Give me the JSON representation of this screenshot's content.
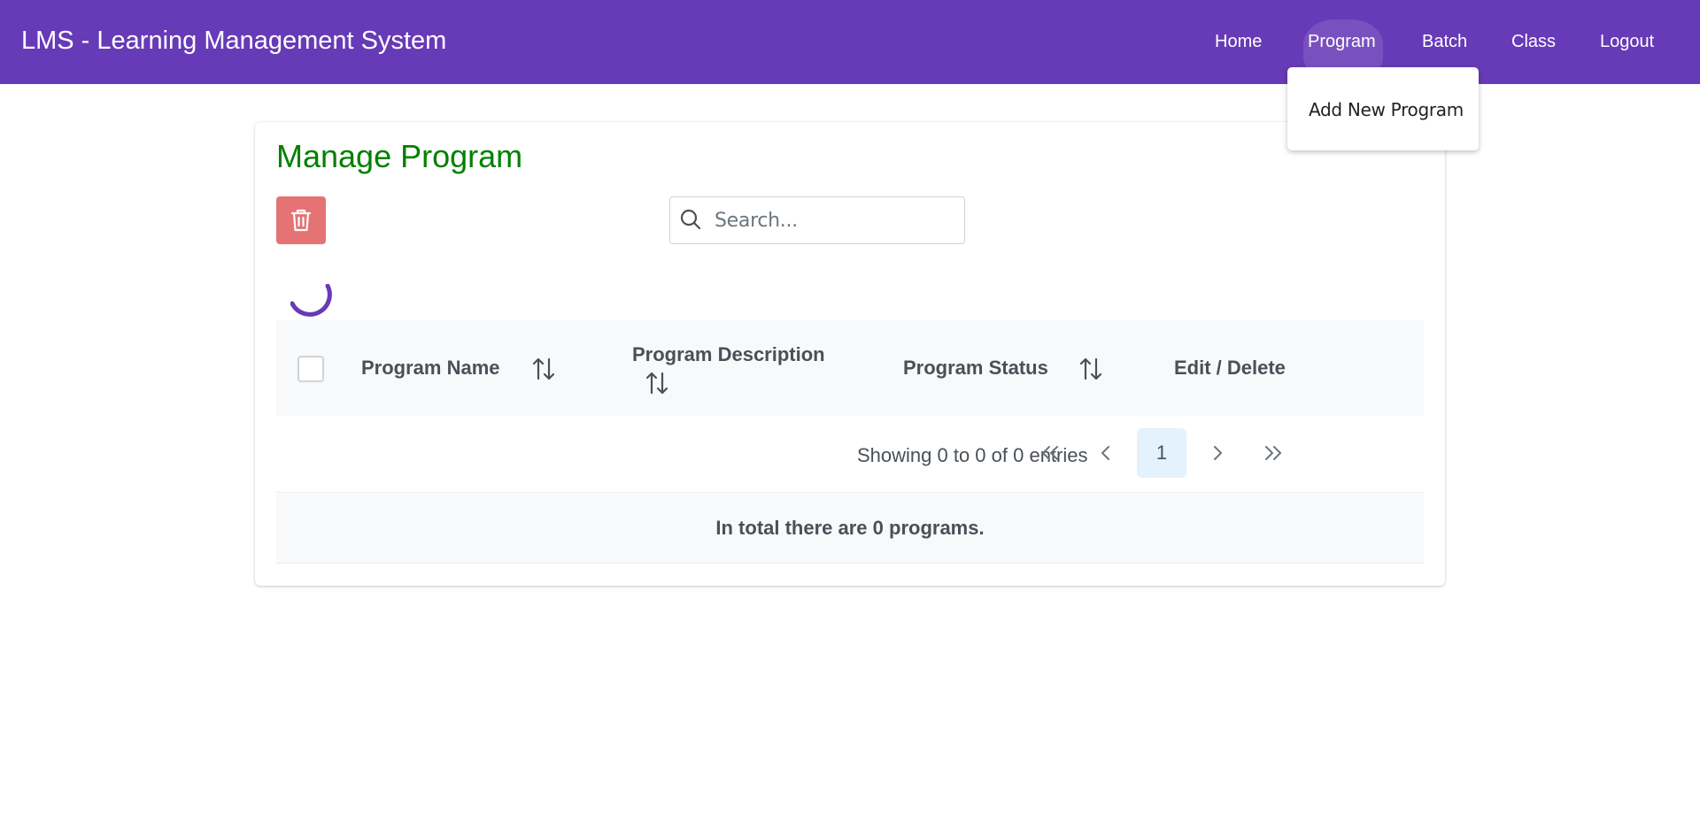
{
  "header": {
    "app_title": "LMS - Learning Management System",
    "nav": [
      {
        "label": "Home"
      },
      {
        "label": "Program"
      },
      {
        "label": "Batch"
      },
      {
        "label": "Class"
      },
      {
        "label": "Logout"
      }
    ],
    "active_nav": "Program",
    "background_color": "#673ab7"
  },
  "dropdown": {
    "items": [
      {
        "label": "Add New Program"
      }
    ]
  },
  "main": {
    "title": "Manage Program",
    "title_color": "#008000",
    "delete_button_color": "#e57373",
    "delete_icon": "trash-icon",
    "search": {
      "placeholder": "Search...",
      "value": "",
      "icon": "search-icon"
    },
    "table": {
      "columns": [
        {
          "label": "Program Name",
          "sortable": true
        },
        {
          "label": "Program Description",
          "sortable": true
        },
        {
          "label": "Program Status",
          "sortable": true
        },
        {
          "label": "Edit / Delete",
          "sortable": false
        }
      ],
      "rows": []
    },
    "paginator": {
      "report": "Showing 0 to 0 of 0 entries",
      "current_page": "1"
    },
    "footer": "In total there are 0 programs."
  }
}
